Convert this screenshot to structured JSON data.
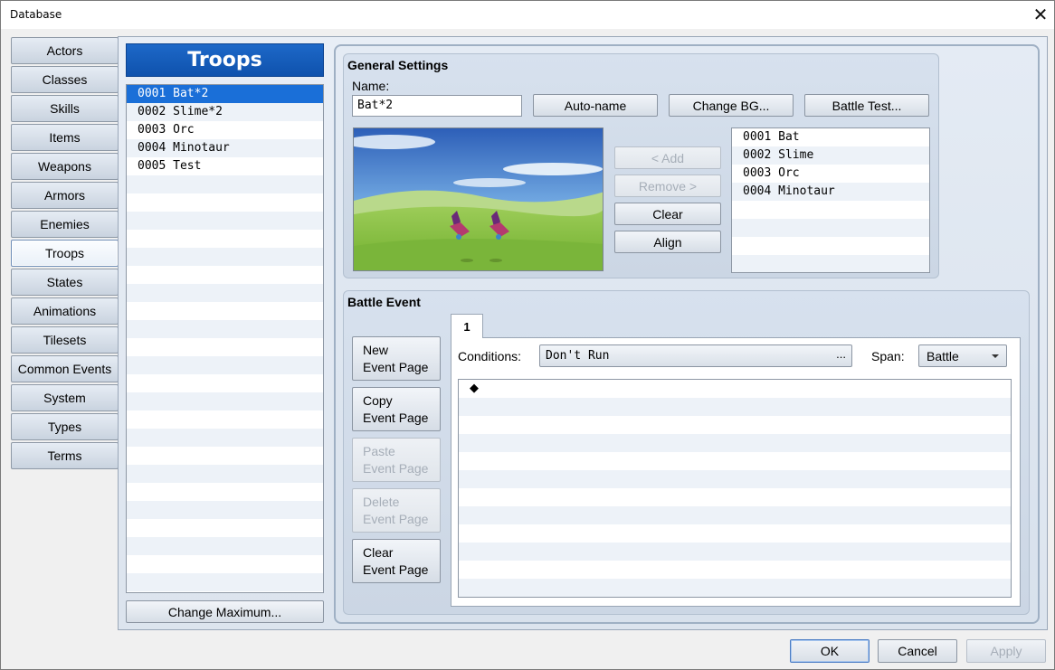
{
  "window": {
    "title": "Database",
    "close_glyph": "✕"
  },
  "categories": [
    {
      "label": "Actors"
    },
    {
      "label": "Classes"
    },
    {
      "label": "Skills"
    },
    {
      "label": "Items"
    },
    {
      "label": "Weapons"
    },
    {
      "label": "Armors"
    },
    {
      "label": "Enemies"
    },
    {
      "label": "Troops",
      "active": true
    },
    {
      "label": "States"
    },
    {
      "label": "Animations"
    },
    {
      "label": "Tilesets"
    },
    {
      "label": "Common Events"
    },
    {
      "label": "System"
    },
    {
      "label": "Types"
    },
    {
      "label": "Terms"
    }
  ],
  "troops": {
    "header": "Troops",
    "items": [
      "0001 Bat*2",
      "0002 Slime*2",
      "0003 Orc",
      "0004 Minotaur",
      "0005 Test"
    ],
    "selected_index": 0,
    "change_max_label": "Change Maximum..."
  },
  "general": {
    "title": "General Settings",
    "name_label": "Name:",
    "name_value": "Bat*2",
    "auto_name_label": "Auto-name",
    "change_bg_label": "Change BG...",
    "battle_test_label": "Battle Test...",
    "add_label": "< Add",
    "remove_label": "Remove >",
    "clear_label": "Clear",
    "align_label": "Align",
    "enemies": [
      "0001 Bat",
      "0002 Slime",
      "0003 Orc",
      "0004 Minotaur"
    ]
  },
  "battle_event": {
    "title": "Battle Event",
    "tab_label": "1",
    "new_page": [
      "New",
      "Event Page"
    ],
    "copy_page": [
      "Copy",
      "Event Page"
    ],
    "paste_page": [
      "Paste",
      "Event Page"
    ],
    "delete_page": [
      "Delete",
      "Event Page"
    ],
    "clear_page": [
      "Clear",
      "Event Page"
    ],
    "conditions_label": "Conditions:",
    "conditions_value": "Don't Run",
    "conditions_more": "...",
    "span_label": "Span:",
    "span_value": "Battle",
    "command_marker": "◆"
  },
  "footer": {
    "ok_label": "OK",
    "cancel_label": "Cancel",
    "apply_label": "Apply"
  },
  "colors": {
    "accent": "#1a6fd8",
    "header_blue": "#1560be"
  },
  "icons": {
    "close": "close-icon",
    "dropdown": "chevron-down-icon"
  }
}
